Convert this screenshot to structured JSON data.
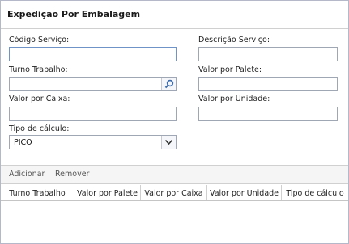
{
  "panel": {
    "title": "Expedição Por Embalagem"
  },
  "form": {
    "codigo_servico": {
      "label": "Código Serviço:",
      "value": ""
    },
    "descricao_servico": {
      "label": "Descrição Serviço:",
      "value": ""
    },
    "turno_trabalho": {
      "label": "Turno Trabalho:",
      "value": "",
      "trigger_icon": "search-icon"
    },
    "valor_por_palete": {
      "label": "Valor por Palete:",
      "value": ""
    },
    "valor_por_caixa": {
      "label": "Valor por Caixa:",
      "value": ""
    },
    "valor_por_unidade": {
      "label": "Valor por Unidade:",
      "value": ""
    },
    "tipo_calculo": {
      "label": "Tipo de cálculo:",
      "value": "PICO",
      "trigger_icon": "chevron-down-icon"
    }
  },
  "toolbar": {
    "add_label": "Adicionar",
    "remove_label": "Remover"
  },
  "grid": {
    "columns": [
      "Turno Trabalho",
      "Valor por Palete",
      "Valor por Caixa",
      "Valor por Unidade",
      "Tipo de cálculo"
    ],
    "rows": []
  }
}
